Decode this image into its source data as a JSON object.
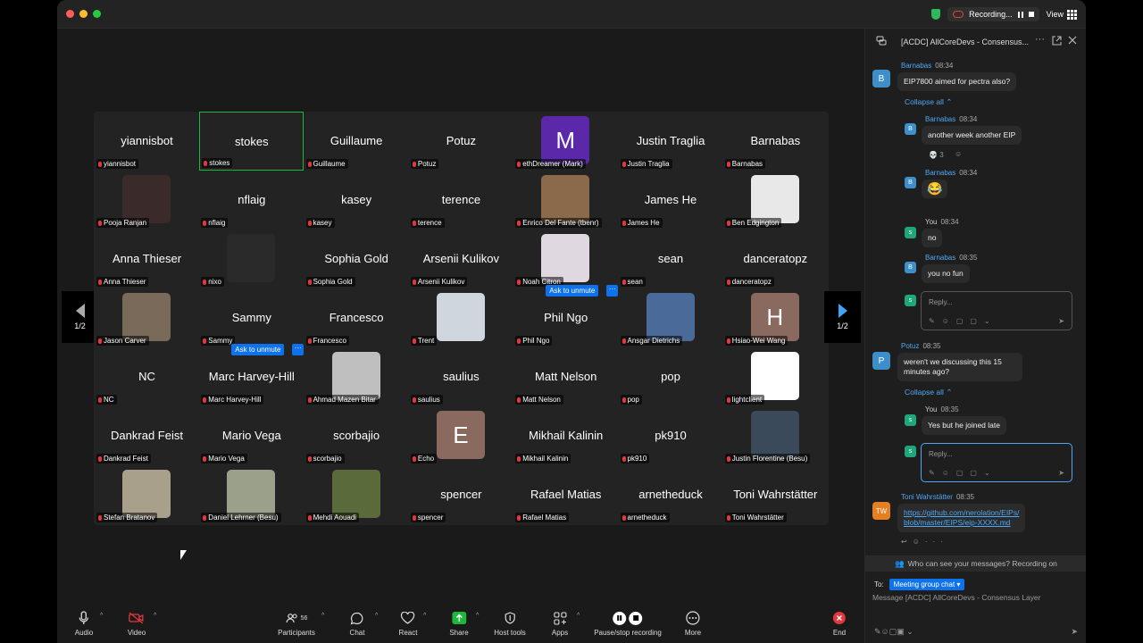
{
  "window": {
    "controls": {
      "close_color": "#fe5f57",
      "min_color": "#febc2e",
      "max_color": "#28c840"
    },
    "recording_label": "Recording...",
    "view_label": "View"
  },
  "gallery": {
    "page_indicator_left": "1/2",
    "page_indicator_right": "1/2",
    "ask_to_unmute_label": "Ask to unmute",
    "participants": [
      {
        "name": "yiannisbot",
        "label": "yiannisbot",
        "display": "yiannisbot"
      },
      {
        "name": "stokes",
        "label": "stokes",
        "display": "stokes",
        "selected": true
      },
      {
        "name": "Guillaume",
        "label": "Guillaume",
        "display": "Guillaume"
      },
      {
        "name": "Potuz",
        "label": "Potuz",
        "display": "Potuz"
      },
      {
        "name": "ethDreamer (Mark)",
        "label": "ethDreamer (Mark)",
        "avatar_letter": "M",
        "avatar_color": "#5a28a8"
      },
      {
        "name": "Justin Traglia",
        "label": "Justin Traglia",
        "display": "Justin Traglia"
      },
      {
        "name": "Barnabas",
        "label": "Barnabas",
        "display": "Barnabas"
      },
      {
        "name": "Pooja Ranjan",
        "label": "Pooja Ranjan",
        "photo_color": "#3a2a2a"
      },
      {
        "name": "nflaig",
        "label": "nflaig",
        "display": "nflaig"
      },
      {
        "name": "kasey",
        "label": "kasey",
        "display": "kasey"
      },
      {
        "name": "terence",
        "label": "terence",
        "display": "terence"
      },
      {
        "name": "Enrico Del Fante (tbenr)",
        "label": "Enrico Del Fante (tbenr)",
        "photo_color": "#8a6a4a"
      },
      {
        "name": "James He",
        "label": "James He",
        "display": "James He"
      },
      {
        "name": "Ben Edgington",
        "label": "Ben Edgington",
        "photo_color": "#e8e8e8"
      },
      {
        "name": "Anna Thieser",
        "label": "Anna Thieser",
        "display": "Anna Thieser"
      },
      {
        "name": "nixo",
        "label": "nixo",
        "photo_color": "#2a2a2a"
      },
      {
        "name": "Sophia Gold",
        "label": "Sophia Gold",
        "display": "Sophia Gold"
      },
      {
        "name": "Arsenii Kulikov",
        "label": "Arsenii Kulikov",
        "display": "Arsenii Kulikov"
      },
      {
        "name": "Noah Citron",
        "label": "Noah Citron",
        "photo_color": "#e0d8e0"
      },
      {
        "name": "sean",
        "label": "sean",
        "display": "sean"
      },
      {
        "name": "danceratopz",
        "label": "danceratopz",
        "display": "danceratopz"
      },
      {
        "name": "Jason Carver",
        "label": "Jason Carver",
        "photo_color": "#7a6a5a"
      },
      {
        "name": "Sammy",
        "label": "Sammy",
        "display": "Sammy"
      },
      {
        "name": "Francesco",
        "label": "Francesco",
        "display": "Francesco"
      },
      {
        "name": "Trent",
        "label": "Trent",
        "photo_color": "#cfd6de"
      },
      {
        "name": "Phil Ngo",
        "label": "Phil Ngo",
        "display": "Phil Ngo",
        "ask": true
      },
      {
        "name": "Ansgar Dietrichs",
        "label": "Ansgar Dietrichs",
        "photo_color": "#4a6a9a"
      },
      {
        "name": "Hsiao-Wei Wang",
        "label": "Hsiao-Wei Wang",
        "avatar_letter": "H",
        "avatar_color": "#8a6a5e"
      },
      {
        "name": "NC",
        "label": "NC",
        "display": "NC"
      },
      {
        "name": "Marc Harvey-Hill",
        "label": "Marc Harvey-Hill",
        "display": "Marc Harvey-Hill",
        "ask": true
      },
      {
        "name": "Ahmad Mazen Bitar",
        "label": "Ahmad Mazen Bitar",
        "photo_color": "#bfbfbf"
      },
      {
        "name": "saulius",
        "label": "saulius",
        "display": "saulius"
      },
      {
        "name": "Matt Nelson",
        "label": "Matt Nelson",
        "display": "Matt Nelson"
      },
      {
        "name": "pop",
        "label": "pop",
        "display": "pop"
      },
      {
        "name": "lightclient",
        "label": "lightclient",
        "photo_color": "#ffffff"
      },
      {
        "name": "Dankrad Feist",
        "label": "Dankrad Feist",
        "display": "Dankrad Feist"
      },
      {
        "name": "Mario Vega",
        "label": "Mario Vega",
        "display": "Mario Vega"
      },
      {
        "name": "scorbajio",
        "label": "scorbajio",
        "display": "scorbajio"
      },
      {
        "name": "Echo",
        "label": "Echo",
        "avatar_letter": "E",
        "avatar_color": "#8a6a5e"
      },
      {
        "name": "Mikhail Kalinin",
        "label": "Mikhail Kalinin",
        "display": "Mikhail Kalinin"
      },
      {
        "name": "pk910",
        "label": "pk910",
        "display": "pk910"
      },
      {
        "name": "Justin Florentine (Besu)",
        "label": "Justin Florentine (Besu)",
        "photo_color": "#3a4a5a"
      },
      {
        "name": "Stefan Bratanov",
        "label": "Stefan Bratanov",
        "photo_color": "#a8a08a"
      },
      {
        "name": "Daniel Lehrner (Besu)",
        "label": "Daniel Lehrner (Besu)",
        "photo_color": "#9aa08a"
      },
      {
        "name": "Mehdi Aouadi",
        "label": "Mehdi Aouadi",
        "photo_color": "#5a6a3a"
      },
      {
        "name": "spencer",
        "label": "spencer",
        "display": "spencer"
      },
      {
        "name": "Rafael Matias",
        "label": "Rafael Matias",
        "display": "Rafael Matias"
      },
      {
        "name": "arnetheduck",
        "label": "arnetheduck",
        "display": "arnetheduck"
      },
      {
        "name": "Toni Wahrstätter",
        "label": "Toni Wahrstätter",
        "display": "Toni Wahrstätter"
      }
    ]
  },
  "toolbar": {
    "audio": "Audio",
    "video": "Video",
    "participants": "Participants",
    "participants_count": "56",
    "chat": "Chat",
    "react": "React",
    "share": "Share",
    "host_tools": "Host tools",
    "apps": "Apps",
    "record": "Pause/stop recording",
    "more": "More",
    "end": "End"
  },
  "chat": {
    "title": "[ACDC] AllCoreDevs - Consensus...",
    "collapse_all": "Collapse all",
    "reply_placeholder": "Reply...",
    "messages": {
      "m1": {
        "sender": "Barnabas",
        "time": "08:34",
        "text": "EIP7800 aimed for pectra also?",
        "avatar": "B"
      },
      "m1r1": {
        "sender": "Barnabas",
        "time": "08:34",
        "text": "another week another EIP",
        "avatar": "B",
        "reaction": "3"
      },
      "m1r2": {
        "sender": "Barnabas",
        "time": "08:34",
        "emoji": "😂",
        "avatar": "B"
      },
      "m1r3": {
        "sender": "You",
        "time": "08:34",
        "text": "no",
        "avatar": "s"
      },
      "m1r4": {
        "sender": "Barnabas",
        "time": "08:35",
        "text": "you no fun",
        "avatar": "B"
      },
      "m2": {
        "sender": "Potuz",
        "time": "08:35",
        "text": "weren't we discussing this 15 minutes ago?",
        "avatar": "P"
      },
      "m2r1": {
        "sender": "You",
        "time": "08:35",
        "text": "Yes but he joined late",
        "avatar": "s"
      },
      "m3": {
        "sender": "Toni Wahrstätter",
        "time": "08:35",
        "link": "https://github.com/nerolation/EIPs/blob/master/EIPS/eip-XXXX.md",
        "link_line1": "https://github.com/nerolation/EIPs/",
        "link_line2": "blob/master/EIPS/eip-XXXX.md",
        "avatar": "TW"
      }
    },
    "privacy": "Who can see your messages? Recording on",
    "to_label": "To:",
    "to_value": "Meeting group chat",
    "message_placeholder": "Message [ACDC] AllCoreDevs - Consensus Layer",
    "colors": {
      "barnabas": "#3e8fc9",
      "you": "#1fa67a",
      "potuz": "#3e8fc9",
      "toni": "#e67e22"
    }
  }
}
